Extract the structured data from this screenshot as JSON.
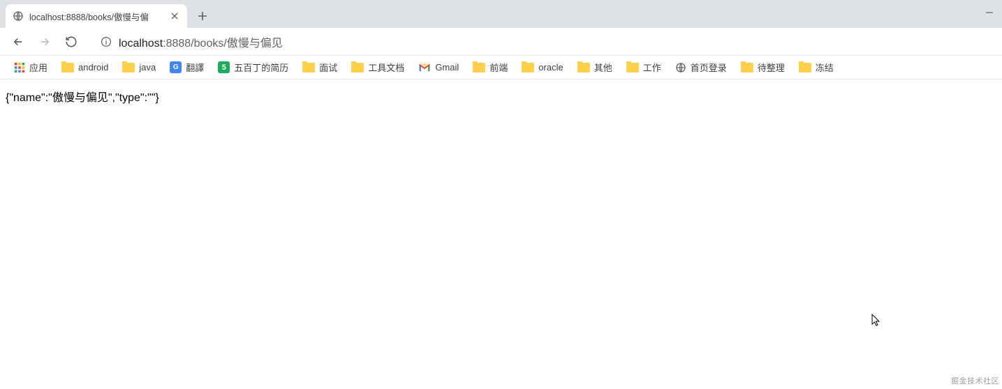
{
  "tab": {
    "title": "localhost:8888/books/傲慢与偏"
  },
  "url": {
    "host": "localhost",
    "port": ":8888",
    "path": "/books/傲慢与偏见"
  },
  "bookmarks": {
    "apps": "应用",
    "items": [
      {
        "label": "android",
        "icon": "folder"
      },
      {
        "label": "java",
        "icon": "folder"
      },
      {
        "label": "翻譯",
        "icon": "gtranslate"
      },
      {
        "label": "五百丁的简历",
        "icon": "green"
      },
      {
        "label": "面试",
        "icon": "folder"
      },
      {
        "label": "工具文档",
        "icon": "folder"
      },
      {
        "label": "Gmail",
        "icon": "gmail"
      },
      {
        "label": "前端",
        "icon": "folder"
      },
      {
        "label": "oracle",
        "icon": "folder"
      },
      {
        "label": "其他",
        "icon": "folder"
      },
      {
        "label": "工作",
        "icon": "folder"
      },
      {
        "label": "首页登录",
        "icon": "globe"
      },
      {
        "label": "待整理",
        "icon": "folder"
      },
      {
        "label": "冻结",
        "icon": "folder"
      }
    ]
  },
  "body_text": "{\"name\":\"傲慢与偏见\",\"type\":\"\"}",
  "watermark": "掘金技术社区"
}
